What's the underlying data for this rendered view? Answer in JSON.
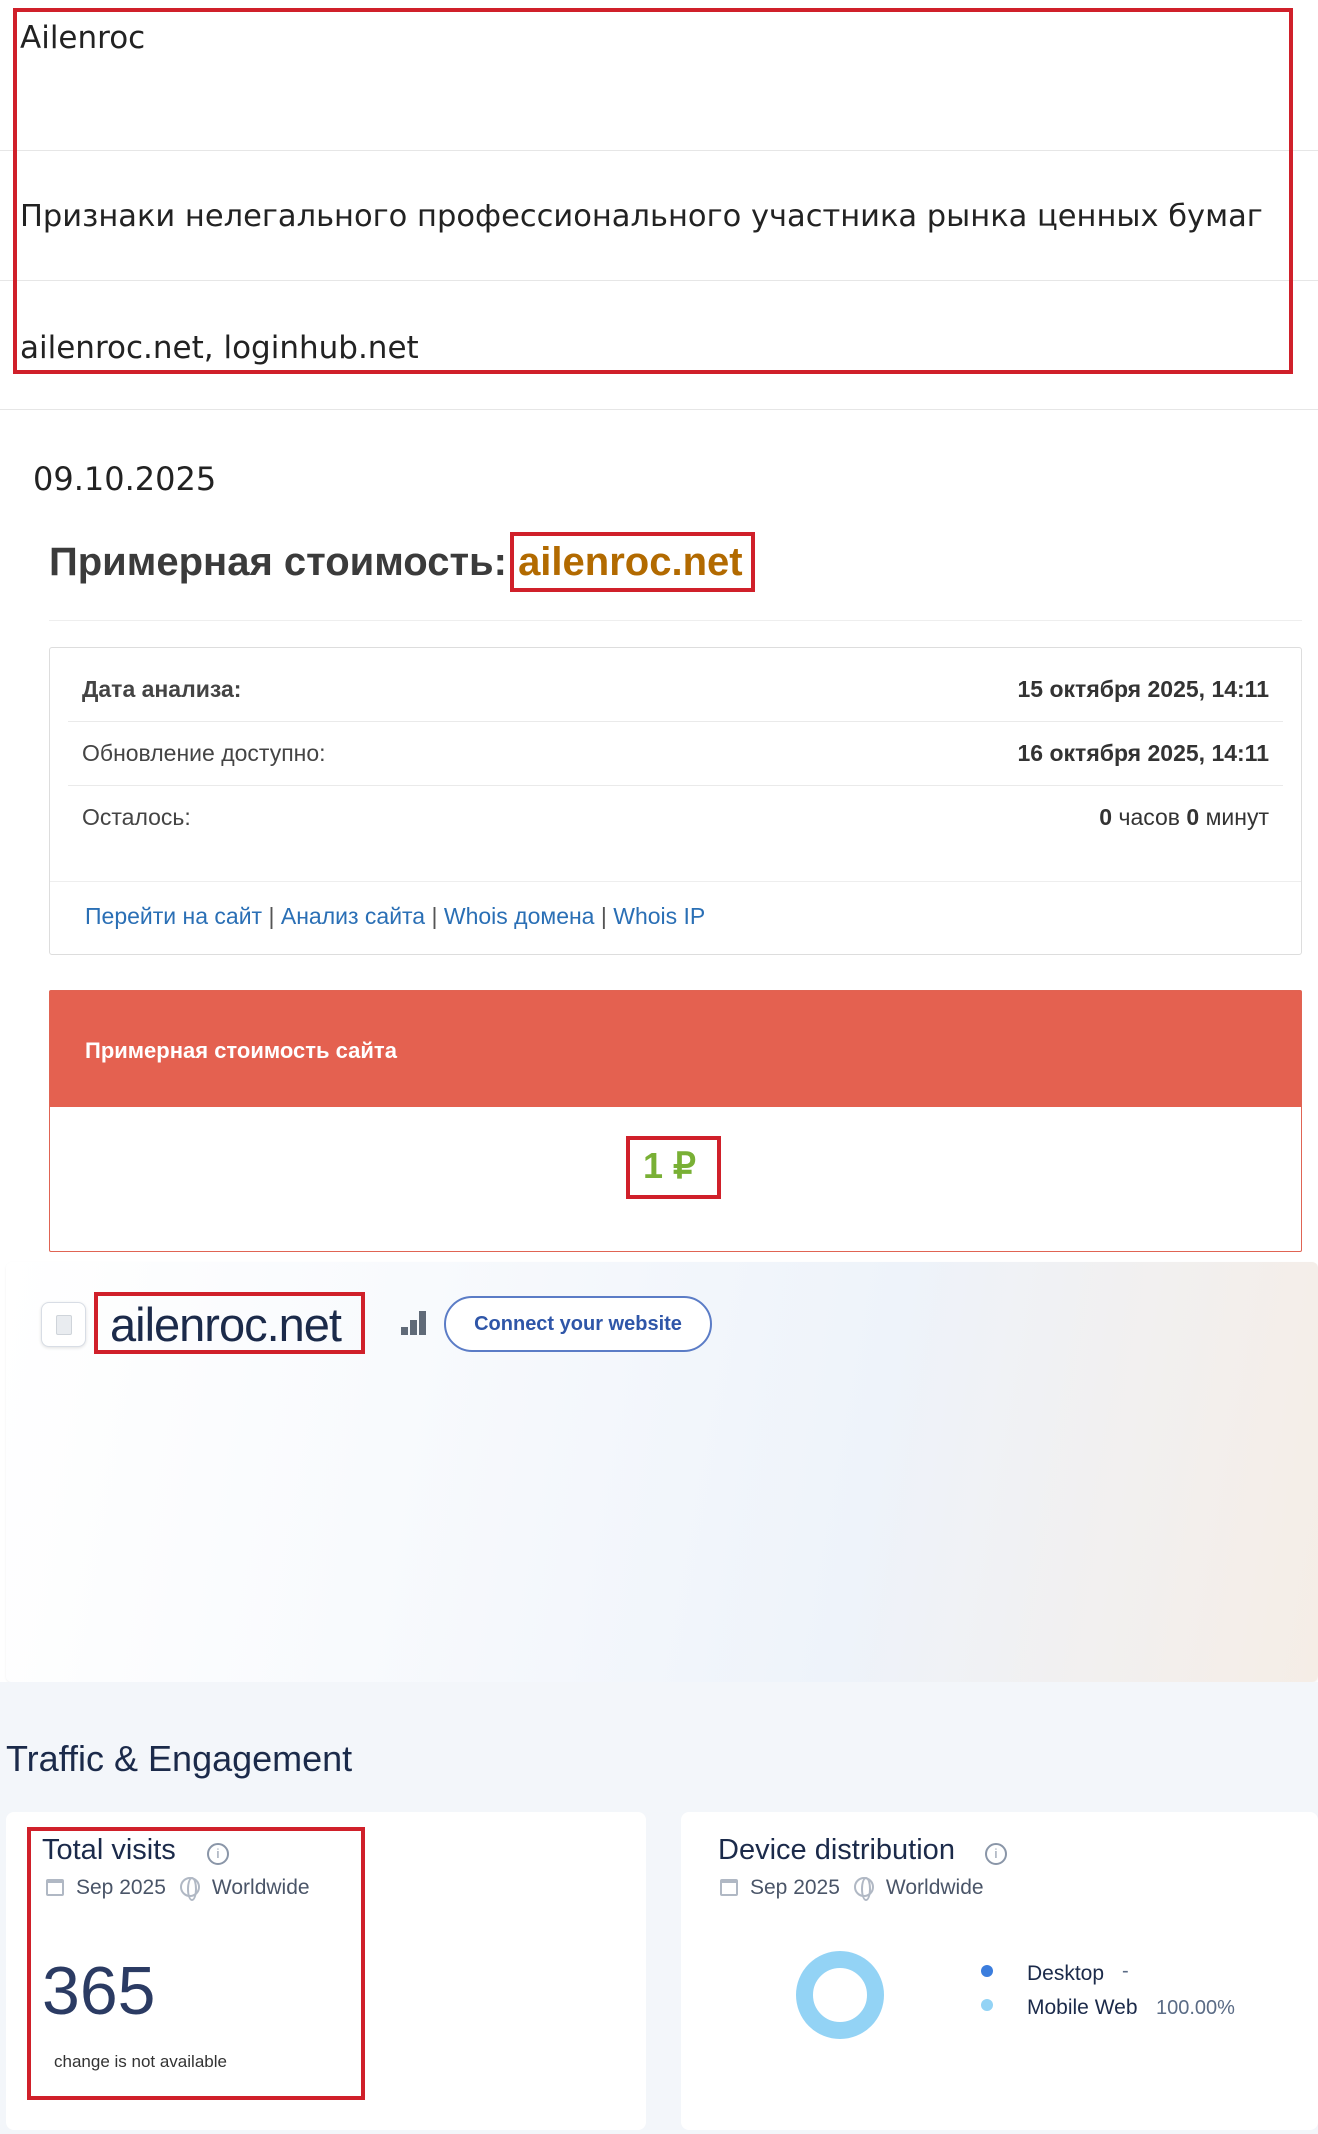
{
  "info": {
    "name": "Ailenroc",
    "description": "Признаки нелегального профессионального участника рынка ценных бумаг",
    "domains": "ailenroc.net, loginhub.net"
  },
  "cost": {
    "date": "09.10.2025",
    "heading_prefix": "Примерная стоимость: ",
    "heading_domain": "ailenroc.net",
    "rows": [
      {
        "label": "Дата анализа:",
        "value": "15 октября 2025, 14:11"
      },
      {
        "label": "Обновление доступно:",
        "value": "16 октября 2025, 14:11"
      },
      {
        "label": "Осталось:",
        "hours_num": "0",
        "hours_unit": " часов ",
        "min_num": "0",
        "min_unit": " минут"
      }
    ],
    "links": [
      "Перейти на сайт",
      "Анализ сайта",
      "Whois домена",
      "Whois IP"
    ],
    "link_sep": " | ",
    "price_title": "Примерная стоимость сайта",
    "price_value": "1 ₽"
  },
  "similarweb": {
    "domain": "ailenroc.net",
    "connect_label": "Connect your website",
    "section_title": "Traffic & Engagement",
    "total_visits": {
      "title": "Total visits",
      "period": "Sep 2025",
      "region": "Worldwide",
      "value": "365",
      "note": "change is not available"
    },
    "device": {
      "title": "Device distribution",
      "period": "Sep 2025",
      "region": "Worldwide",
      "items": [
        {
          "label": "Desktop",
          "value": "-",
          "color": "#3b7ddd"
        },
        {
          "label": "Mobile Web",
          "value": "100.00%",
          "color": "#93d3f5"
        }
      ]
    }
  },
  "colors": {
    "highlight_border": "#d0202a",
    "price_header": "#e46150",
    "price_value": "#79b035",
    "heading_domain": "#b26a00",
    "link": "#2a6fb5"
  }
}
